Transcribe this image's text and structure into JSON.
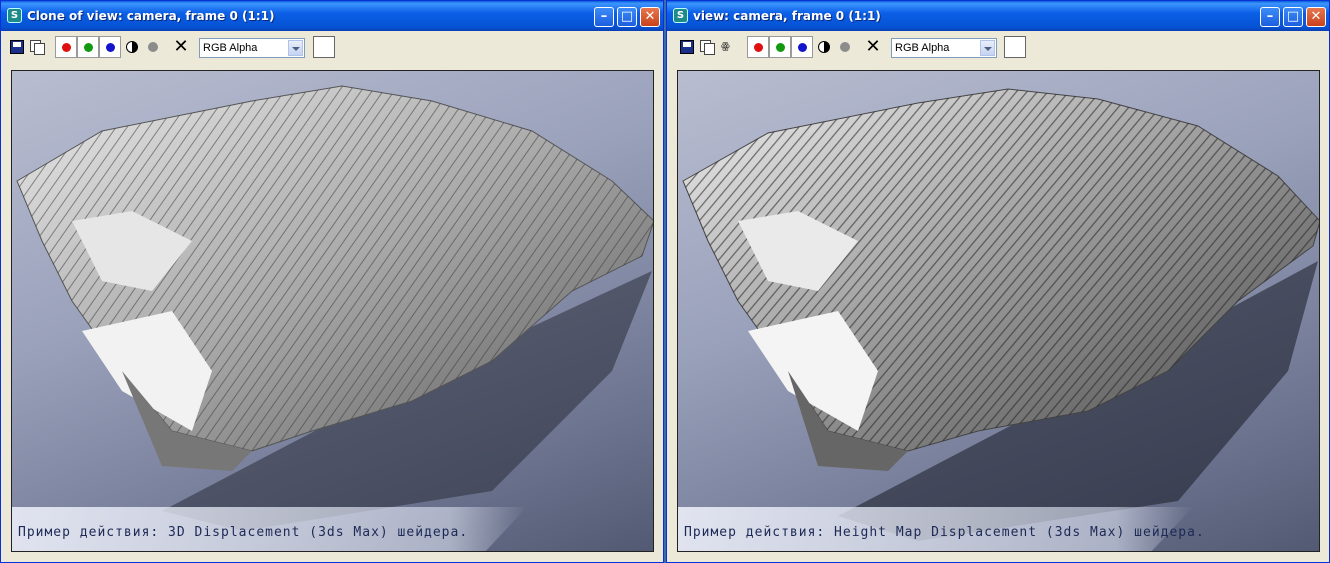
{
  "windows": [
    {
      "title": "Clone of view: camera, frame 0 (1:1)",
      "channel_select": "RGB Alpha",
      "caption": "Пример действия: 3D Displacement (3ds Max) шейдера."
    },
    {
      "title": "view: camera, frame 0 (1:1)",
      "channel_select": "RGB Alpha",
      "caption": "Пример действия: Height Map Displacement (3ds Max) шейдера."
    }
  ],
  "titlebar_buttons": {
    "minimize": "–",
    "maximize": "□",
    "close": "✕"
  },
  "icons": {
    "app": "3ds-max-icon",
    "save": "save-icon",
    "copy": "copy-image-icon",
    "clone": "clone-window-icon",
    "mono": "monochrome-icon",
    "clear": "clear-icon"
  },
  "colors": {
    "red_channel": "#e01010",
    "green_channel": "#129912",
    "blue_channel": "#1414cc",
    "titlebar": "#0a5fd8"
  }
}
